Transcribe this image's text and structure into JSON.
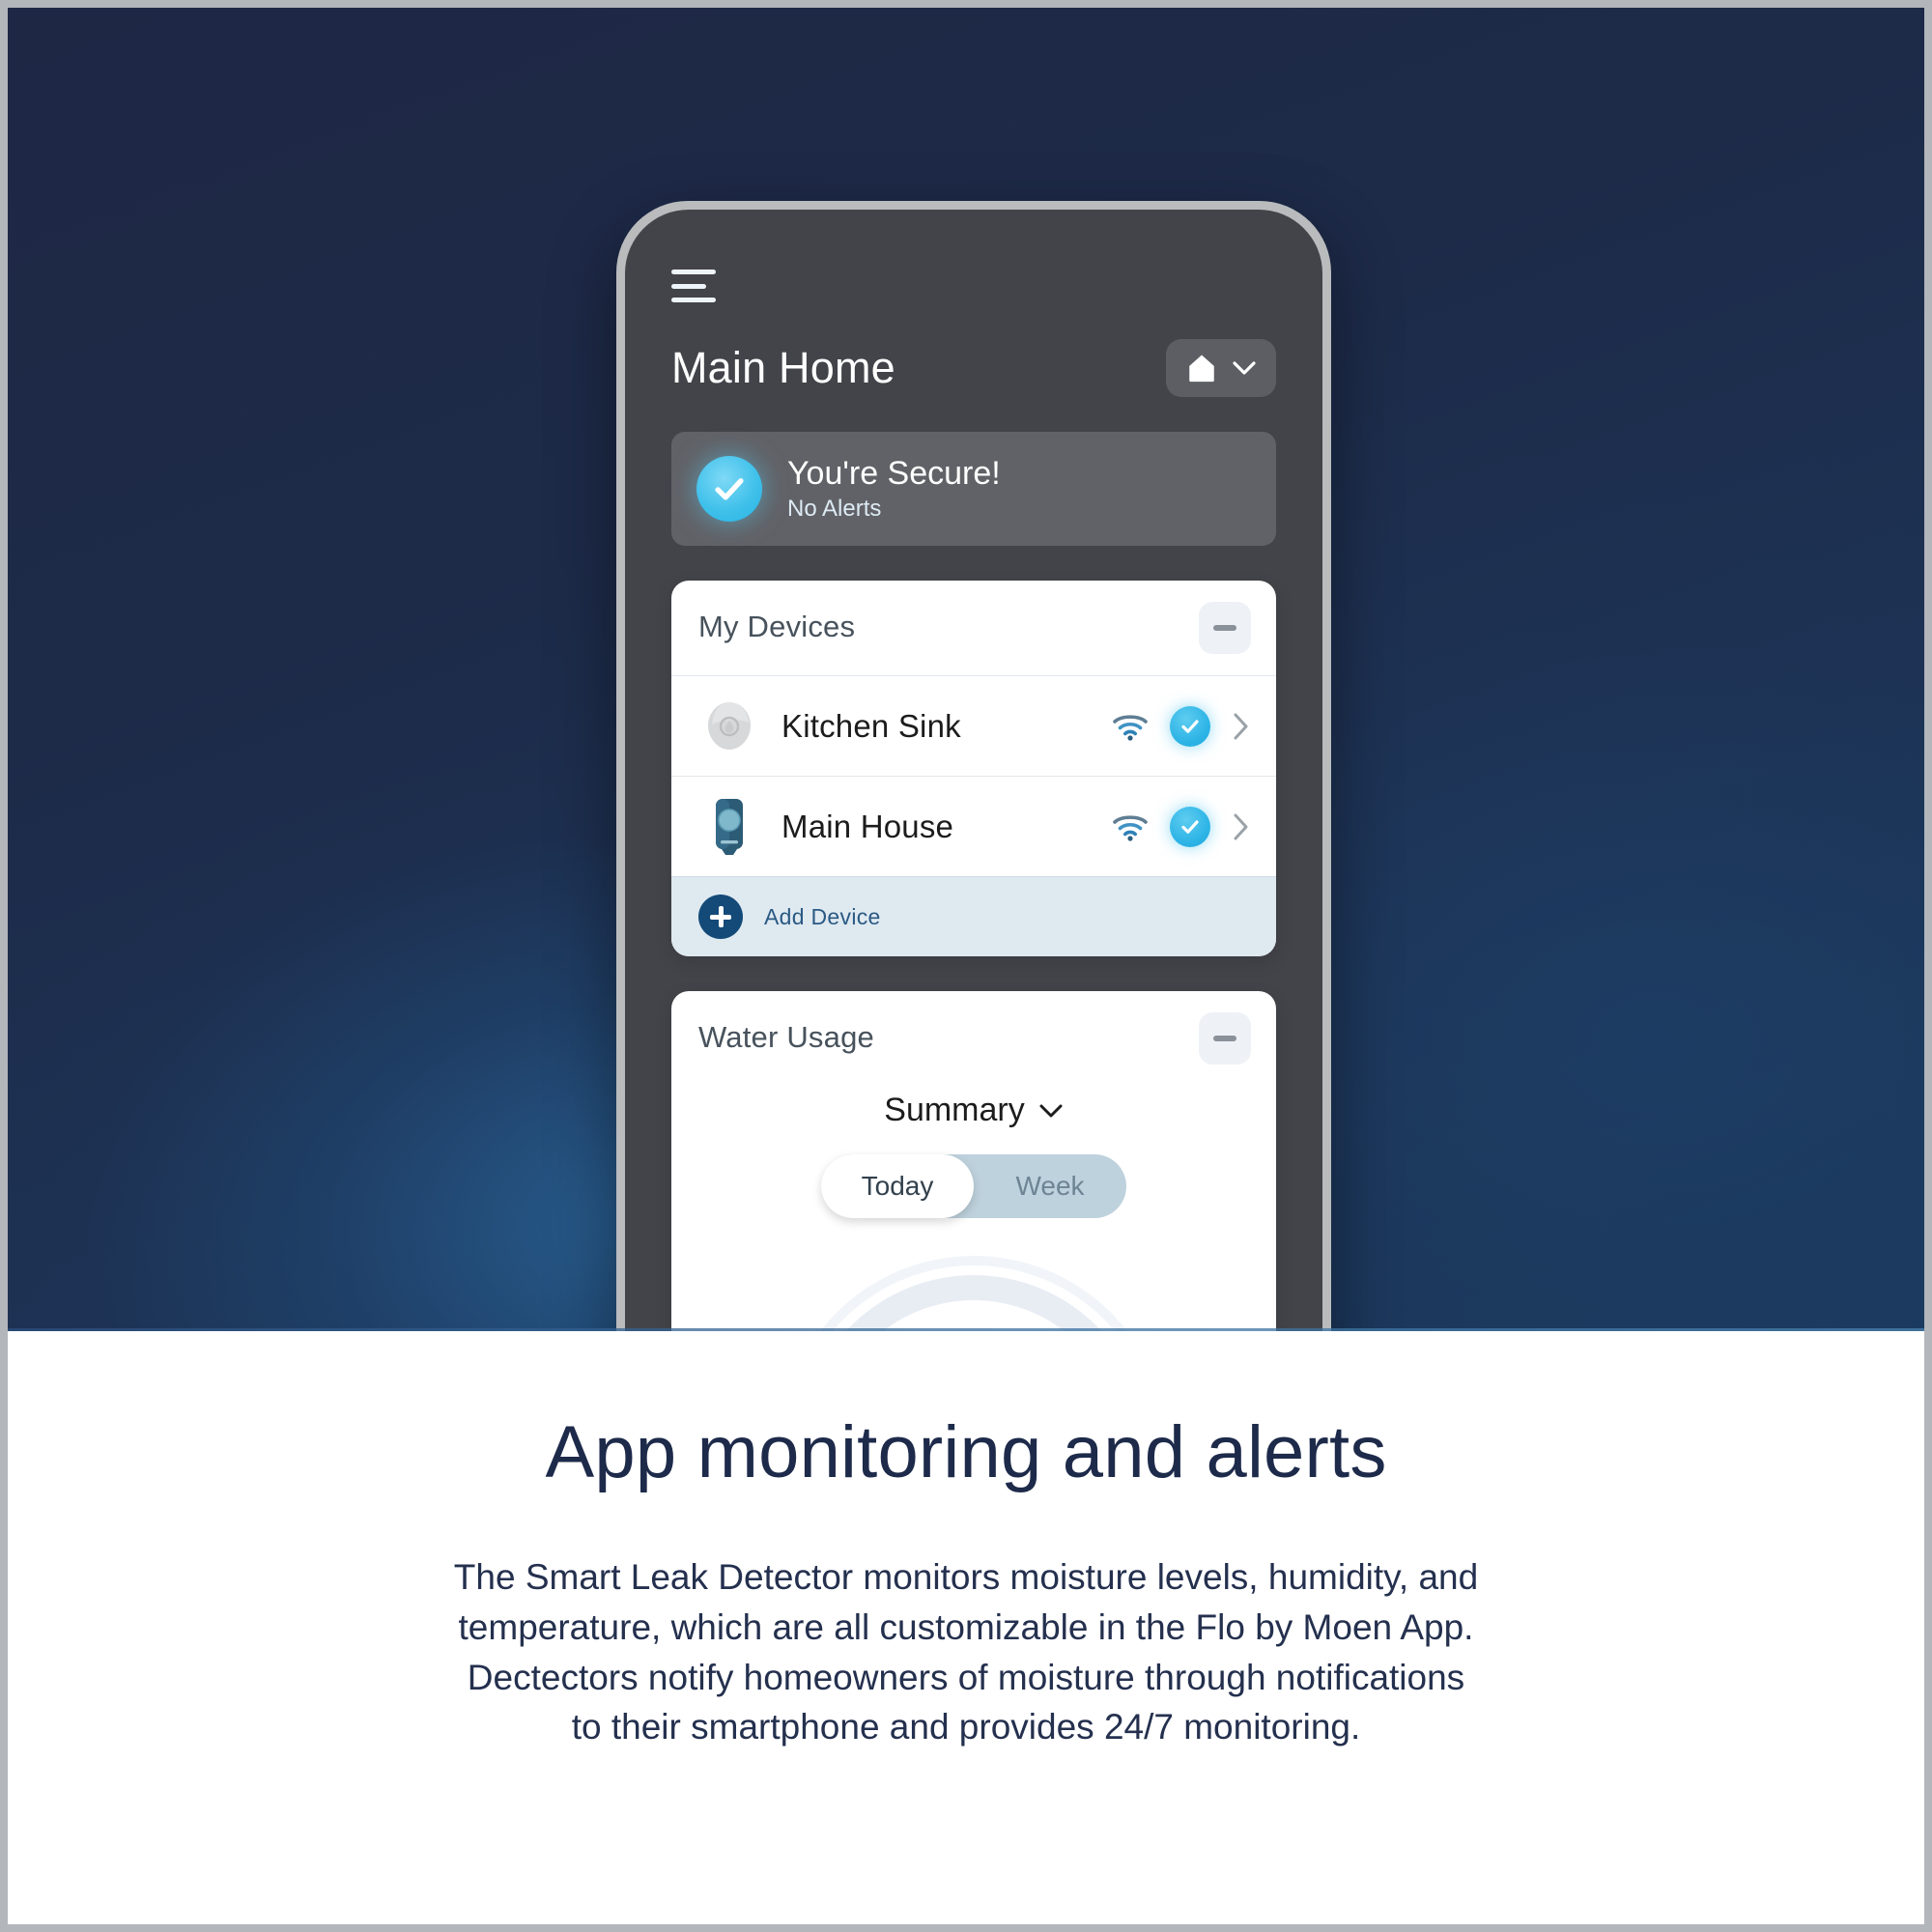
{
  "phone_app": {
    "menu_icon": "hamburger-menu-icon",
    "home_title": "Main Home",
    "home_selector": {
      "icon": "house-icon",
      "chevron": "chevron-down-icon"
    },
    "status_banner": {
      "icon": "check-circle-icon",
      "title": "You're Secure!",
      "subtitle": "No Alerts"
    },
    "devices_card": {
      "title": "My Devices",
      "collapse_icon": "minus-icon",
      "rows": [
        {
          "name": "Kitchen Sink",
          "device_icon": "leak-detector-puck-icon",
          "wifi_icon": "wifi-icon",
          "status_icon": "check-circle-icon",
          "chevron_icon": "chevron-right-icon"
        },
        {
          "name": "Main House",
          "device_icon": "shutoff-valve-icon",
          "wifi_icon": "wifi-icon",
          "status_icon": "check-circle-icon",
          "chevron_icon": "chevron-right-icon"
        }
      ],
      "add_device": {
        "icon": "plus-circle-icon",
        "label": "Add Device"
      }
    },
    "water_usage_card": {
      "title": "Water Usage",
      "collapse_icon": "minus-icon",
      "summary_label": "Summary",
      "summary_chevron": "chevron-down-icon",
      "range_toggle": {
        "options": [
          "Today",
          "Week"
        ],
        "selected": "Today"
      }
    }
  },
  "copy": {
    "headline": "App monitoring and alerts",
    "body_lines": [
      "The Smart Leak Detector monitors moisture levels, humidity, and",
      "temperature, which are all customizable in the Flo by Moen App.",
      "Dectectors notify homeowners of moisture through notifications",
      "to their smartphone and provides 24/7 monitoring."
    ]
  },
  "colors": {
    "background_navy": "#1e2845",
    "background_blue_glow": "#2b689e",
    "app_blue": "#166192",
    "accent_cyan": "#2db4e6",
    "headline_navy": "#1d2a4a",
    "add_device_navy": "#134a78"
  }
}
